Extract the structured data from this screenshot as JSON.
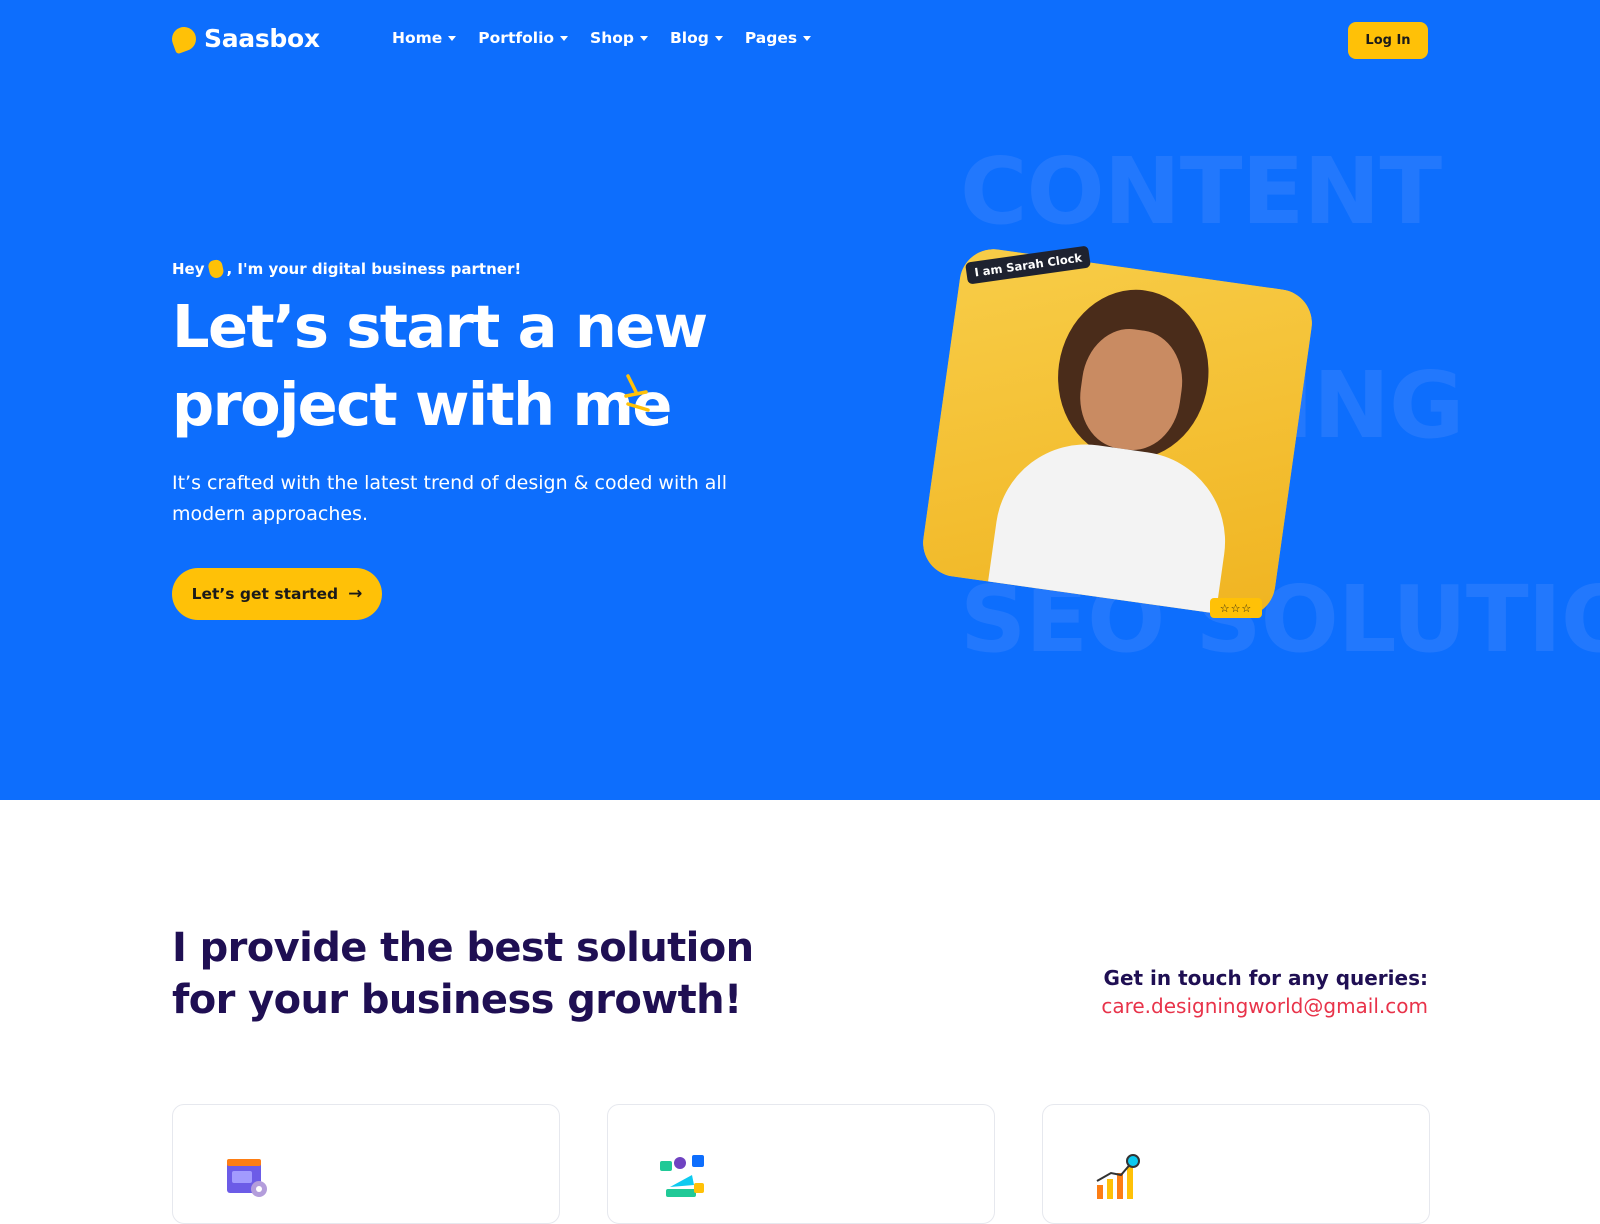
{
  "header": {
    "brand": "Saasbox",
    "nav": [
      {
        "label": "Home"
      },
      {
        "label": "Portfolio"
      },
      {
        "label": "Shop"
      },
      {
        "label": "Blog"
      },
      {
        "label": "Pages"
      }
    ],
    "login_label": "Log In"
  },
  "hero": {
    "kicker_pre": "Hey",
    "kicker_post": ", I'm your digital business partner!",
    "title_line1": "Let’s start a new",
    "title_line2": "project with me",
    "description": "It’s crafted with the latest trend of design & coded with all modern approaches.",
    "cta_label": "Let’s get started",
    "background_words": [
      "CONTENT",
      "TING",
      "SEO SOLUTION"
    ],
    "name_badge": "I am Sarah Clock",
    "rating_stars": "☆☆☆"
  },
  "solutions": {
    "title": "I provide the best solution for your business growth!",
    "contact_label": "Get in touch for any queries:",
    "contact_email": "care.designingworld@gmail.com"
  },
  "colors": {
    "primary": "#0d6efd",
    "accent": "#ffc107",
    "heading": "#1f0f53",
    "email": "#e8334a"
  },
  "icons": [
    "hand-wave-icon",
    "sparkle-icon",
    "arrow-right-icon",
    "web-design-icon",
    "social-marketing-icon",
    "growth-chart-icon"
  ]
}
